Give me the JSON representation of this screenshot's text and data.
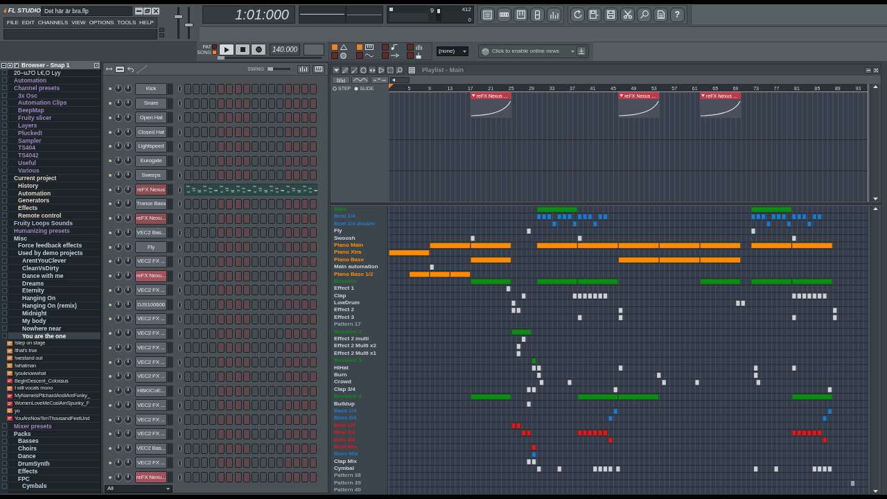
{
  "title_bar": {
    "logo": "FL STUDIO",
    "file_name": "Det här är bra.flp"
  },
  "menu": [
    "FILE",
    "EDIT",
    "CHANNELS",
    "VIEW",
    "OPTIONS",
    "TOOLS",
    "HELP"
  ],
  "master_sliders": [
    {
      "level": 0.72
    },
    {
      "level": 0.42
    }
  ],
  "time_display": "1:01:000",
  "cpu_readings": [
    "9",
    "412",
    "0"
  ],
  "help_button": "?",
  "transport": {
    "modes": [
      {
        "label": "PAT",
        "selected": false
      },
      {
        "label": "SONG",
        "selected": true
      }
    ],
    "song_position": {
      "level": 0
    },
    "tempo": "140.000",
    "record_toggles": [
      {
        "on": true
      },
      {
        "on": true
      },
      {
        "on": false
      },
      {
        "on": false
      },
      {
        "on": false
      },
      {
        "on": false
      },
      {
        "on": false
      },
      {
        "on": false
      }
    ],
    "pattern_selector": "(none)",
    "news": "Click to enable online news"
  },
  "browser": {
    "title": "Browser - Snap 1",
    "path": "20–uJ'O L€,O Lyy",
    "items": [
      {
        "label": "Automation",
        "color": "#9c86bb",
        "selected": false
      },
      {
        "label": "Channel presets",
        "color": "#9c86bb",
        "selected": false,
        "children": [
          {
            "label": "3x Osc",
            "selected": false
          },
          {
            "label": "Automation Clips",
            "selected": false
          },
          {
            "label": "BeepMap",
            "selected": false
          },
          {
            "label": "Fruity slicer",
            "selected": false
          },
          {
            "label": "Layers",
            "selected": false
          },
          {
            "label": "Plucked!",
            "selected": false
          },
          {
            "label": "Sampler",
            "selected": false
          },
          {
            "label": "TS404",
            "selected": false
          },
          {
            "label": "TS4042",
            "selected": false
          },
          {
            "label": "Useful",
            "selected": false
          },
          {
            "label": "Various",
            "selected": false
          }
        ]
      },
      {
        "label": "Current project",
        "color": "#ddd4c4",
        "selected": false,
        "children": [
          {
            "label": "History",
            "selected": false
          },
          {
            "label": "Automation",
            "selected": false
          },
          {
            "label": "Generators",
            "selected": false
          },
          {
            "label": "Effects",
            "selected": false
          },
          {
            "label": "Remote control",
            "selected": false
          }
        ]
      },
      {
        "label": "Fruity Loops Sounds",
        "color": "#aebdcc",
        "selected": false
      },
      {
        "label": "Humanizing presets",
        "color": "#9c86bb",
        "selected": false
      },
      {
        "label": "Misc",
        "color": "#c3cedb",
        "selected": false,
        "children": [
          {
            "label": "Force feedback effects",
            "selected": false
          },
          {
            "label": "Used by demo projects",
            "selected": false,
            "children": [
              {
                "label": "ArentYouClever",
                "selected": false
              },
              {
                "label": "CleanVsDirty",
                "selected": false
              },
              {
                "label": "Dance with me",
                "selected": false
              },
              {
                "label": "Dreams",
                "selected": false
              },
              {
                "label": "Eternity",
                "selected": false
              },
              {
                "label": "Hanging On",
                "selected": false
              },
              {
                "label": "Hanging On (remix)",
                "selected": false
              },
              {
                "label": "Midnight",
                "selected": false
              },
              {
                "label": "My body",
                "selected": false
              },
              {
                "label": "Nowhere near",
                "selected": false
              },
              {
                "label": "You are the one",
                "selected": true,
                "children": [
                  {
                    "label": "!step on stage",
                    "kind": "file",
                    "color": "#c97a3c",
                    "selected": false
                  },
                  {
                    "label": "!that's true",
                    "kind": "file",
                    "color": "#c97a3c",
                    "selected": false
                  },
                  {
                    "label": "!westand out",
                    "kind": "file",
                    "color": "#c97a3c",
                    "selected": false
                  },
                  {
                    "label": "!whatman",
                    "kind": "file",
                    "color": "#c97a3c",
                    "selected": false
                  },
                  {
                    "label": "!youknowwhat",
                    "kind": "file",
                    "color": "#c97a3c",
                    "selected": false
                  },
                  {
                    "label": "BeginDescent_Colossus",
                    "kind": "file",
                    "color": "#c0283a",
                    "selected": false
                  },
                  {
                    "label": "I will vocals mono",
                    "kind": "file",
                    "color": "#c97a3c",
                    "selected": false
                  },
                  {
                    "label": "MyNameIsPilchardAndIAmFunky_",
                    "kind": "file",
                    "color": "#c0283a",
                    "selected": false
                  },
                  {
                    "label": "WomenLoveMeCosIAmSpunky_F",
                    "kind": "file",
                    "color": "#c0283a",
                    "selected": false
                  },
                  {
                    "label": "yo",
                    "kind": "file",
                    "color": "#c97a3c",
                    "selected": false
                  },
                  {
                    "label": "YouAreNowTenThousandFeetUnd",
                    "kind": "file",
                    "color": "#c0283a",
                    "selected": false
                  }
                ]
              }
            ]
          }
        ]
      },
      {
        "label": "Mixer presets",
        "color": "#9c86bb",
        "selected": false
      },
      {
        "label": "Packs",
        "color": "#c3cedb",
        "selected": false,
        "children": [
          {
            "label": "Basses",
            "selected": false
          },
          {
            "label": "Choirs",
            "selected": false
          },
          {
            "label": "Dance",
            "selected": false
          },
          {
            "label": "DrumSynth",
            "selected": false
          },
          {
            "label": "Effects",
            "selected": false
          },
          {
            "label": "FPC",
            "selected": false,
            "children": [
              {
                "label": "Cymbals",
                "selected": false
              }
            ]
          }
        ]
      }
    ]
  },
  "channel_rack": {
    "swing": {
      "label": "SWING",
      "level": 0.05
    },
    "channels": [
      {
        "name": "Kick",
        "color": "#5d646b",
        "kind": "steps"
      },
      {
        "name": "Snare",
        "color": "#5d646b",
        "kind": "steps"
      },
      {
        "name": "Open Hat",
        "color": "#5d646b",
        "kind": "steps"
      },
      {
        "name": "Closed Hat",
        "color": "#5d646b",
        "kind": "steps"
      },
      {
        "name": "Lightspeed",
        "color": "#5d646b",
        "kind": "steps"
      },
      {
        "name": "Eurogate",
        "color": "#5d646b",
        "kind": "steps"
      },
      {
        "name": "Sweeps",
        "color": "#5d646b",
        "kind": "steps"
      },
      {
        "name": "reFX Nexus",
        "color": "#8c4d55",
        "kind": "pianoroll"
      },
      {
        "name": "Trance Bass",
        "color": "#5d646b",
        "kind": "steps"
      },
      {
        "name": "reFX Nexu...",
        "color": "#8c4d55",
        "kind": "steps"
      },
      {
        "name": "VEC2 Bas...",
        "color": "#5d646b",
        "kind": "steps"
      },
      {
        "name": "Fly",
        "color": "#5d646b",
        "kind": "steps"
      },
      {
        "name": "VEC2 FX ...",
        "color": "#5d646b",
        "kind": "steps"
      },
      {
        "name": "reFX Nexu...",
        "color": "#a3525b",
        "kind": "steps"
      },
      {
        "name": "VEC2 FX ...",
        "color": "#5d646b",
        "kind": "steps"
      },
      {
        "name": "DJS100606",
        "color": "#5d646b",
        "kind": "steps"
      },
      {
        "name": "VEC2 FX ...",
        "color": "#5d646b",
        "kind": "steps"
      },
      {
        "name": "VEC2 FX ...",
        "color": "#5d646b",
        "kind": "steps"
      },
      {
        "name": "VEC2 FX ...",
        "color": "#5d646b",
        "kind": "steps"
      },
      {
        "name": "VEC2 FX ...",
        "color": "#5d646b",
        "kind": "steps"
      },
      {
        "name": "VEC2 FX ...",
        "color": "#5d646b",
        "kind": "steps"
      },
      {
        "name": "HBIGCoE...",
        "color": "#5d646b",
        "kind": "steps"
      },
      {
        "name": "VEC2 FX ...",
        "color": "#5d646b",
        "kind": "steps"
      },
      {
        "name": "VEC2 FX ...",
        "color": "#5d646b",
        "kind": "steps"
      },
      {
        "name": "VEC2 FX ...",
        "color": "#5d646b",
        "kind": "steps"
      },
      {
        "name": "VEC2 Bas...",
        "color": "#5d646b",
        "kind": "steps"
      },
      {
        "name": "VEC2 FX ...",
        "color": "#5d646b",
        "kind": "steps"
      },
      {
        "name": "reFX Nexu...",
        "color": "#a3525b",
        "kind": "steps"
      }
    ],
    "filter": "All"
  },
  "playlist": {
    "title": "Playlist - Main",
    "snap_modes": [
      {
        "label": "STEP",
        "selected": false
      },
      {
        "label": "SLIDE",
        "selected": true
      }
    ],
    "chart_data": [
      {
        "type": "bar",
        "orientation": "horizontal",
        "grid": true,
        "tick_labels": "x",
        "xlim": [
          1,
          95
        ],
        "xticks": [
          5,
          9,
          13,
          17,
          21,
          25,
          29,
          33,
          37,
          41,
          45,
          49,
          53,
          57,
          61,
          65,
          69,
          73,
          77,
          81,
          85,
          89,
          93
        ],
        "categories": [
          null
        ],
        "series": [
          {
            "color": "#c0384a",
            "base": [
              17
            ],
            "values": [
              8
            ]
          },
          {
            "color": "#c0384a",
            "base": [
              46
            ],
            "values": [
              8
            ]
          },
          {
            "color": "#c0384a",
            "base": [
              62
            ],
            "values": [
              8
            ]
          }
        ],
        "annotations": [
          "reFX Nexus ...",
          "reFX Nexus ...",
          "reFX Nexus ..."
        ]
      }
    ],
    "patterns": [
      {
        "name": "Main",
        "color": "#0c8c14"
      },
      {
        "name": "Beat 1/4",
        "color": "#1e7ac8"
      },
      {
        "name": "Beat 1/4 double",
        "color": "#1e7ac8"
      },
      {
        "name": "Fly",
        "color": "#cdd1d5"
      },
      {
        "name": "Swoosh",
        "color": "#cdd1d5"
      },
      {
        "name": "Piano Main",
        "color": "#ff8c00"
      },
      {
        "name": "Piano Xtra",
        "color": "#ff8c00"
      },
      {
        "name": "Piano Base",
        "color": "#ff8c00"
      },
      {
        "name": "Main automation",
        "color": "#cdd1d5"
      },
      {
        "name": "Piano Base 1/2",
        "color": "#ff8c00"
      },
      {
        "name": "Bassline",
        "color": "#0c8c14"
      },
      {
        "name": "Effect 1",
        "color": "#cdd1d5"
      },
      {
        "name": "Clap",
        "color": "#cdd1d5"
      },
      {
        "name": "LowDrum",
        "color": "#cdd1d5"
      },
      {
        "name": "Effect 2",
        "color": "#cdd1d5"
      },
      {
        "name": "Effect 3",
        "color": "#cdd1d5"
      },
      {
        "name": "Pattern 17",
        "color": "#9aa0a6"
      },
      {
        "name": "Bassline 2",
        "color": "#0c8c14"
      },
      {
        "name": "Effect 2 multi",
        "color": "#cdd1d5"
      },
      {
        "name": "Effect 2 Multi x2",
        "color": "#cdd1d5"
      },
      {
        "name": "Effect 2 Multi x1",
        "color": "#cdd1d5"
      },
      {
        "name": "Bassline 3",
        "color": "#0c8c14"
      },
      {
        "name": "HiHat",
        "color": "#cdd1d5"
      },
      {
        "name": "Burn",
        "color": "#cdd1d5"
      },
      {
        "name": "Crowd",
        "color": "#cdd1d5"
      },
      {
        "name": "Clap 3/4",
        "color": "#cdd1d5"
      },
      {
        "name": "Bassline 4",
        "color": "#0c8c14"
      },
      {
        "name": "Buildup",
        "color": "#cdd1d5"
      },
      {
        "name": "Bass 1/4",
        "color": "#1e7ac8"
      },
      {
        "name": "Bass 3/4",
        "color": "#1e7ac8"
      },
      {
        "name": "Beat 1/4",
        "color": "#e01818"
      },
      {
        "name": "Beat 2/4",
        "color": "#e01818"
      },
      {
        "name": "Beat 3/4",
        "color": "#e01818"
      },
      {
        "name": "Beat Mix",
        "color": "#e01818"
      },
      {
        "name": "Bass Mix",
        "color": "#1e7ac8"
      },
      {
        "name": "Clap Mix",
        "color": "#cdd1d5"
      },
      {
        "name": "Cymbal",
        "color": "#cdd1d5"
      },
      {
        "name": "Pattern 38",
        "color": "#9aa0a6"
      },
      {
        "name": "Pattern 39",
        "color": "#9aa0a6"
      },
      {
        "name": "Pattern 40",
        "color": "#9aa0a6"
      }
    ]
  }
}
